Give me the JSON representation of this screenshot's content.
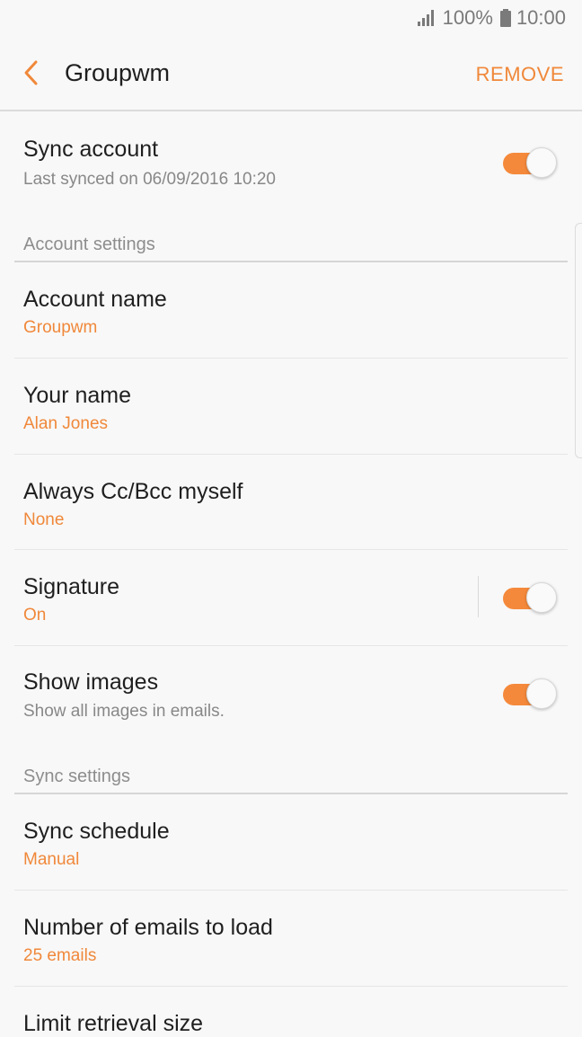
{
  "status_bar": {
    "battery": "100%",
    "time": "10:00",
    "icons": [
      "signal-icon",
      "battery-icon"
    ]
  },
  "header": {
    "title": "Groupwm",
    "action": "REMOVE",
    "back_icon": "chevron-left-icon"
  },
  "colors": {
    "accent": "#f0883a",
    "toggle_on": "#f5893b",
    "background": "#f8f8f8"
  },
  "sync_account": {
    "label": "Sync account",
    "subtitle": "Last synced on 06/09/2016  10:20",
    "enabled": true
  },
  "account_settings": {
    "header": "Account settings",
    "account_name": {
      "label": "Account name",
      "value": "Groupwm"
    },
    "your_name": {
      "label": "Your name",
      "value": "Alan Jones"
    },
    "cc_bcc": {
      "label": "Always Cc/Bcc myself",
      "value": "None"
    },
    "signature": {
      "label": "Signature",
      "value": "On",
      "enabled": true
    },
    "show_images": {
      "label": "Show images",
      "subtitle": "Show all images in emails.",
      "enabled": true
    }
  },
  "sync_settings": {
    "header": "Sync settings",
    "sync_schedule": {
      "label": "Sync schedule",
      "value": "Manual"
    },
    "emails_to_load": {
      "label": "Number of emails to load",
      "value": "25 emails"
    },
    "limit_retrieval": {
      "label": "Limit retrieval size"
    }
  }
}
